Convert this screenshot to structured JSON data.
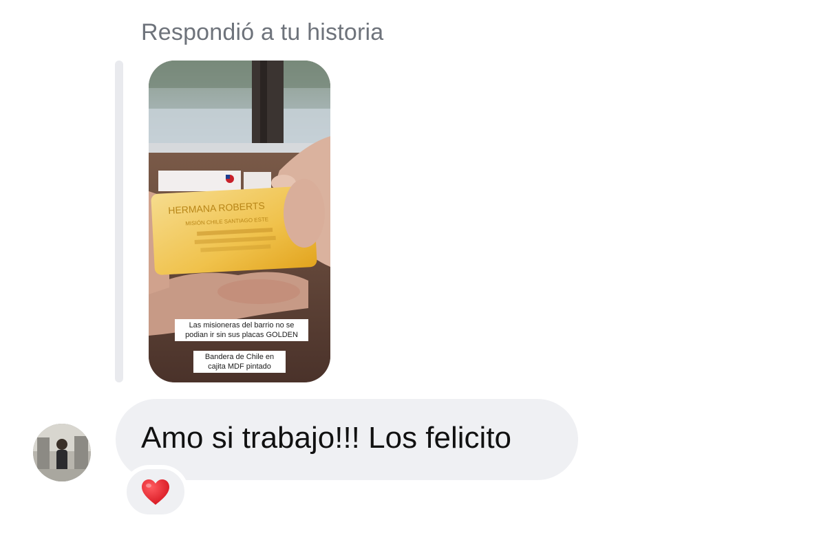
{
  "reply_header": "Respondió a tu historia",
  "story": {
    "plate_text_title": "HERMANA ROBERTS",
    "plate_text_sub": "MISIÓN CHILE SANTIAGO ESTE",
    "caption_1": "Las misioneras del barrio no se podian ir sin sus placas GOLDEN",
    "caption_2": "Bandera de Chile en cajita MDF pintado"
  },
  "message": {
    "text": "Amo si trabajo!!! Los felicito",
    "reaction": "heart"
  },
  "colors": {
    "bubble_bg": "#eff0f3",
    "header_text": "#6e737b",
    "reaction_red": "#e8202a",
    "plate_gold": "#f2c64a"
  },
  "icons": {
    "reaction": "heart-icon",
    "avatar": "avatar-photo"
  }
}
